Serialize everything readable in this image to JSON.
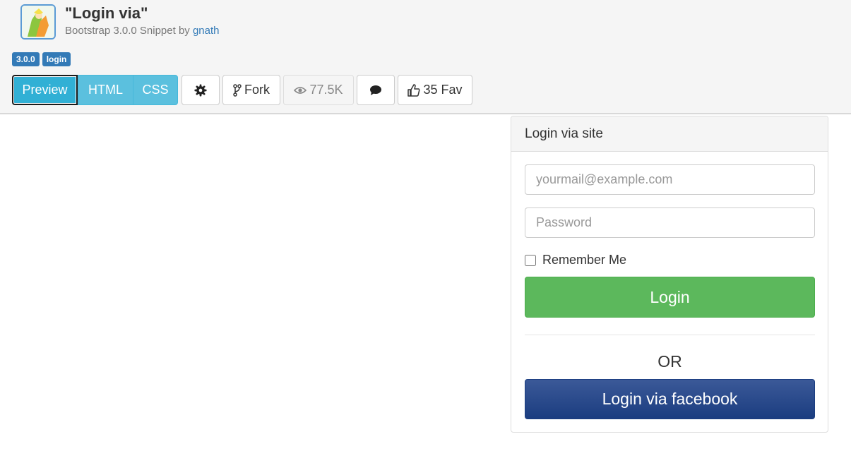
{
  "header": {
    "title": "\"Login via\"",
    "subtitle_prefix": "Bootstrap 3.0.0 Snippet by ",
    "author": "gnath"
  },
  "tags": [
    "3.0.0",
    "login"
  ],
  "toolbar": {
    "preview_label": "Preview",
    "html_label": "HTML",
    "css_label": "CSS",
    "fork_label": "Fork",
    "views_label": "77.5K",
    "fav_label": "35 Fav"
  },
  "login_panel": {
    "heading": "Login via site",
    "email_placeholder": "yourmail@example.com",
    "password_placeholder": "Password",
    "remember_label": "Remember Me",
    "login_label": "Login",
    "or_label": "OR",
    "facebook_label": "Login via facebook"
  },
  "colors": {
    "primary": "#337ab7",
    "info": "#5bc0de",
    "success": "#5cb85c",
    "facebook": "#1b3d80"
  }
}
